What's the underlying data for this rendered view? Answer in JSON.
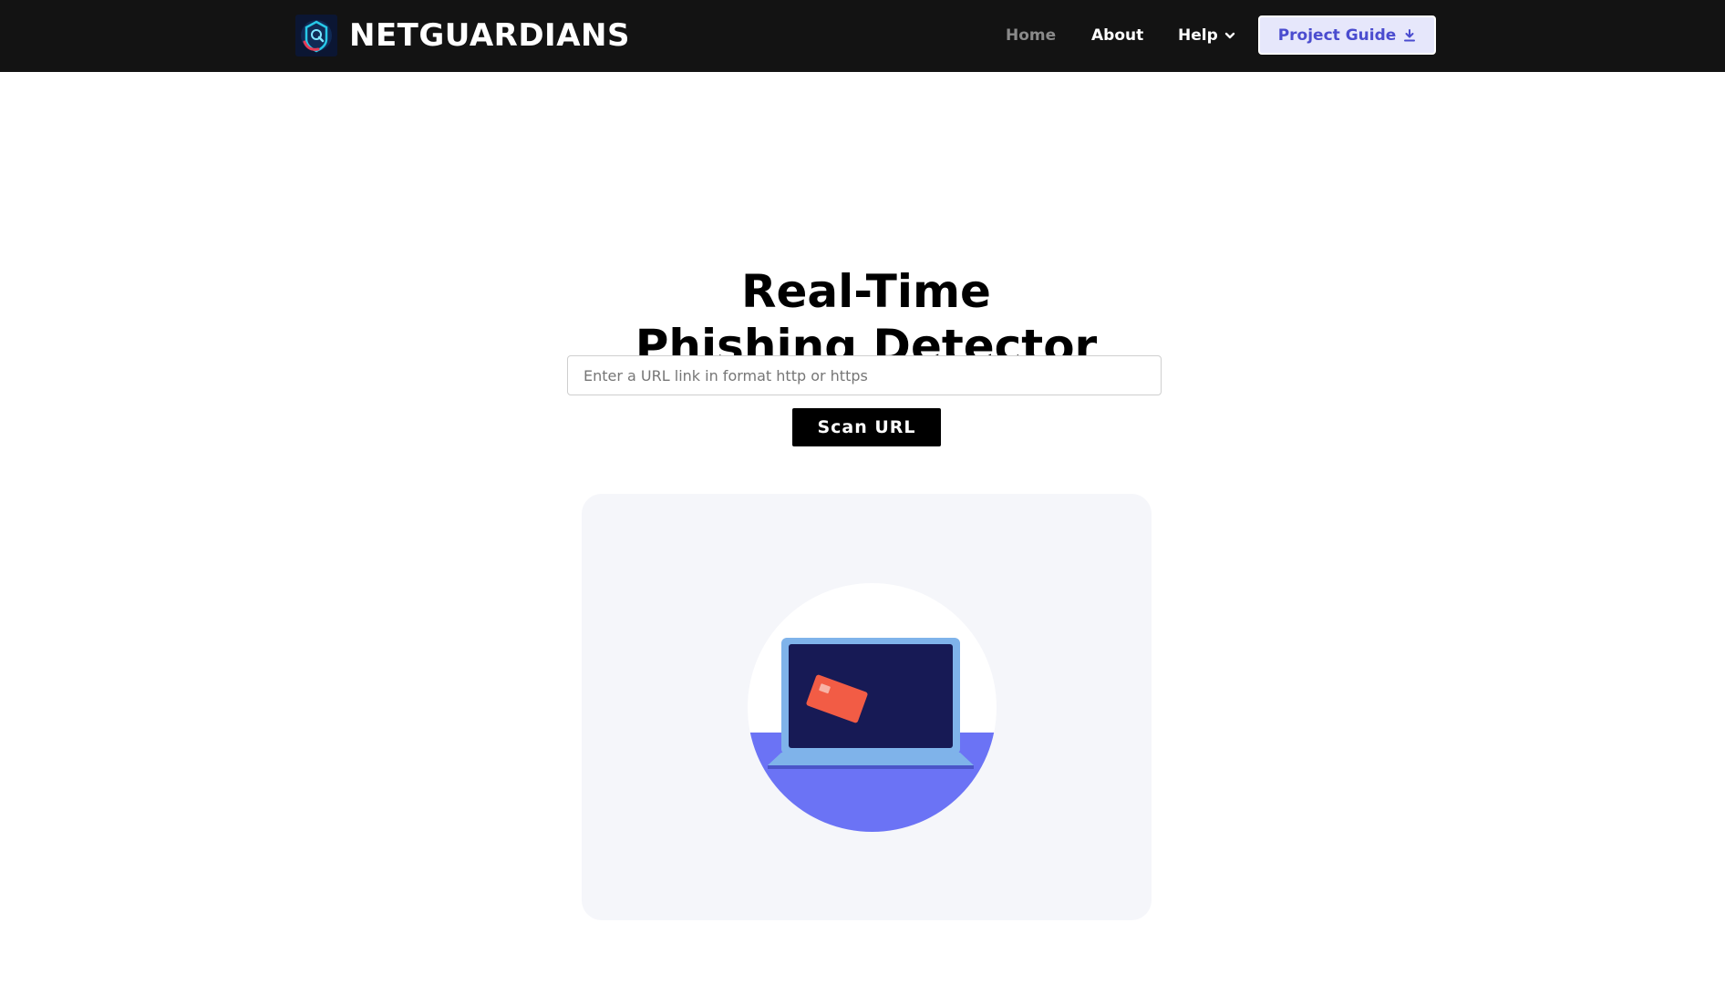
{
  "navbar": {
    "brand_name": "NETGUARDIANS",
    "logo": "netguardians-logo-icon",
    "links": {
      "home": "Home",
      "about": "About",
      "help": "Help"
    },
    "help_icon": "chevron-down-icon",
    "guide_button": "Project Guide",
    "guide_icon": "download-icon"
  },
  "hero": {
    "title_line1": "Real-Time",
    "title_line2": "Phishing Detector",
    "url_placeholder": "Enter a URL link in format http or https",
    "url_value": "",
    "scan_button": "Scan URL"
  },
  "illustration": {
    "icon": "laptop-with-credit-card-icon"
  },
  "colors": {
    "navbar_bg": "#131313",
    "accent": "#4a4ccf",
    "guide_bg": "#e6e7fb",
    "card_bg": "#f5f6fa",
    "laptop_screen": "#171a55",
    "laptop_frame": "#7fb3ea",
    "credit_card": "#f25c45",
    "circle_fill": "#6b73f5"
  }
}
